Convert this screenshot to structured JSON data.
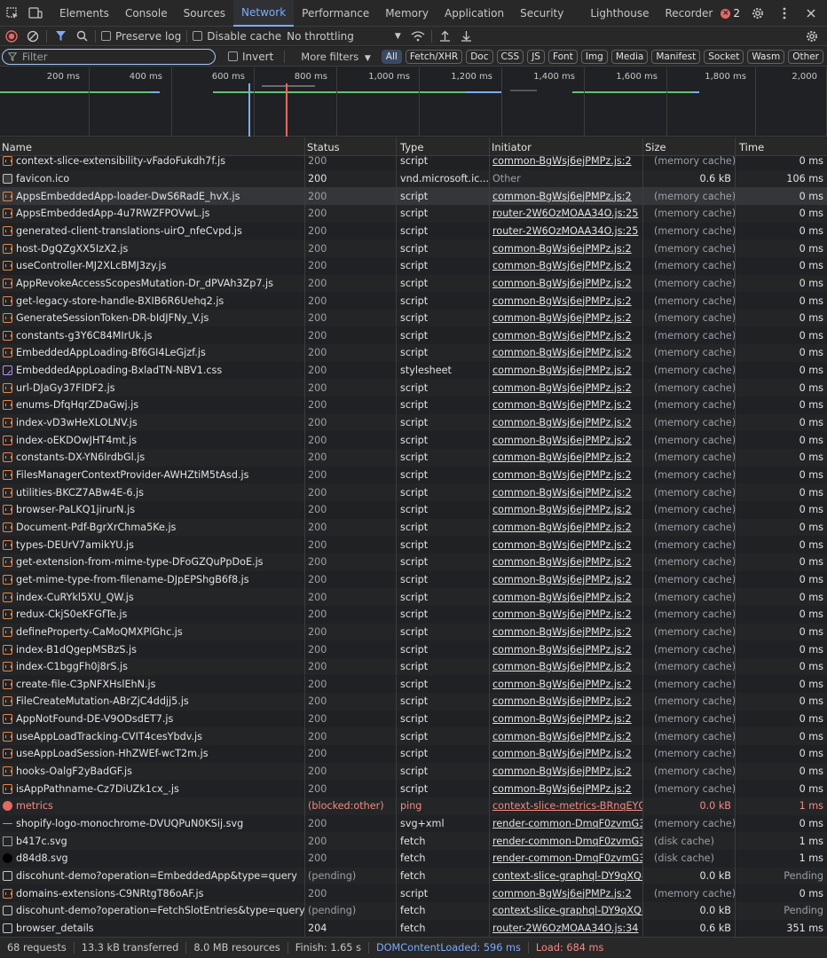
{
  "tabs": [
    "Elements",
    "Console",
    "Sources",
    "Network",
    "Performance",
    "Memory",
    "Application",
    "Security",
    "Lighthouse",
    "Recorder"
  ],
  "active_tab": "Network",
  "error_count": "2",
  "toolbar": {
    "preserve_log": "Preserve log",
    "disable_cache": "Disable cache",
    "throttling": "No throttling"
  },
  "filter": {
    "placeholder": "Filter",
    "invert": "Invert",
    "more_filters": "More filters"
  },
  "type_filters": [
    "All",
    "Fetch/XHR",
    "Doc",
    "CSS",
    "JS",
    "Font",
    "Img",
    "Media",
    "Manifest",
    "Socket",
    "Wasm",
    "Other"
  ],
  "overview_ticks": [
    "200 ms",
    "400 ms",
    "600 ms",
    "800 ms",
    "1,000 ms",
    "1,200 ms",
    "1,400 ms",
    "1,600 ms",
    "1,800 ms",
    "2,000"
  ],
  "columns": {
    "name": "Name",
    "status": "Status",
    "type": "Type",
    "initiator": "Initiator",
    "size": "Size",
    "time": "Time"
  },
  "rows": [
    {
      "name": "context-slice-extensibility-vFadoFukdh7f.js",
      "status": "200",
      "type": "script",
      "initiator": "common-BgWsj6ejPMPz.js:2",
      "size": "(memory cache)",
      "time": "0 ms",
      "icon": "script"
    },
    {
      "name": "favicon.ico",
      "status": "200",
      "type": "vnd.microsoft.ic...",
      "initiator": "Other",
      "size": "0.6 kB",
      "time": "106 ms",
      "icon": "doc"
    },
    {
      "name": "AppsEmbeddedApp-loader-DwS6RadE_hvX.js",
      "status": "200",
      "type": "script",
      "initiator": "common-BgWsj6ejPMPz.js:2",
      "size": "(memory cache)",
      "time": "0 ms",
      "icon": "script"
    },
    {
      "name": "AppsEmbeddedApp-4u7RWZFPOVwL.js",
      "status": "200",
      "type": "script",
      "initiator": "router-2W6OzMOAA34O.js:25",
      "size": "(memory cache)",
      "time": "0 ms",
      "icon": "script"
    },
    {
      "name": "generated-client-translations-uirO_nfeCvpd.js",
      "status": "200",
      "type": "script",
      "initiator": "router-2W6OzMOAA34O.js:25",
      "size": "(memory cache)",
      "time": "0 ms",
      "icon": "script"
    },
    {
      "name": "host-DgQZgXX5IzX2.js",
      "status": "200",
      "type": "script",
      "initiator": "common-BgWsj6ejPMPz.js:2",
      "size": "(memory cache)",
      "time": "0 ms",
      "icon": "script"
    },
    {
      "name": "useController-MJ2XLcBMJ3zy.js",
      "status": "200",
      "type": "script",
      "initiator": "common-BgWsj6ejPMPz.js:2",
      "size": "(memory cache)",
      "time": "0 ms",
      "icon": "script"
    },
    {
      "name": "AppRevokeAccessScopesMutation-Dr_dPVAh3Zp7.js",
      "status": "200",
      "type": "script",
      "initiator": "common-BgWsj6ejPMPz.js:2",
      "size": "(memory cache)",
      "time": "0 ms",
      "icon": "script"
    },
    {
      "name": "get-legacy-store-handle-BXIB6R6Uehq2.js",
      "status": "200",
      "type": "script",
      "initiator": "common-BgWsj6ejPMPz.js:2",
      "size": "(memory cache)",
      "time": "0 ms",
      "icon": "script"
    },
    {
      "name": "GenerateSessionToken-DR-bIdJFNy_V.js",
      "status": "200",
      "type": "script",
      "initiator": "common-BgWsj6ejPMPz.js:2",
      "size": "(memory cache)",
      "time": "0 ms",
      "icon": "script"
    },
    {
      "name": "constants-g3Y6C84MIrUk.js",
      "status": "200",
      "type": "script",
      "initiator": "common-BgWsj6ejPMPz.js:2",
      "size": "(memory cache)",
      "time": "0 ms",
      "icon": "script"
    },
    {
      "name": "EmbeddedAppLoading-Bf6GI4LeGjzf.js",
      "status": "200",
      "type": "script",
      "initiator": "common-BgWsj6ejPMPz.js:2",
      "size": "(memory cache)",
      "time": "0 ms",
      "icon": "script"
    },
    {
      "name": "EmbeddedAppLoading-BxladTN-NBV1.css",
      "status": "200",
      "type": "stylesheet",
      "initiator": "common-BgWsj6ejPMPz.js:2",
      "size": "(memory cache)",
      "time": "0 ms",
      "icon": "css"
    },
    {
      "name": "url-DJaGy37FIDF2.js",
      "status": "200",
      "type": "script",
      "initiator": "common-BgWsj6ejPMPz.js:2",
      "size": "(memory cache)",
      "time": "0 ms",
      "icon": "script"
    },
    {
      "name": "enums-DfqHqrZDaGwj.js",
      "status": "200",
      "type": "script",
      "initiator": "common-BgWsj6ejPMPz.js:2",
      "size": "(memory cache)",
      "time": "0 ms",
      "icon": "script"
    },
    {
      "name": "index-vD3wHeXLOLNV.js",
      "status": "200",
      "type": "script",
      "initiator": "common-BgWsj6ejPMPz.js:2",
      "size": "(memory cache)",
      "time": "0 ms",
      "icon": "script"
    },
    {
      "name": "index-oEKDOwJHT4mt.js",
      "status": "200",
      "type": "script",
      "initiator": "common-BgWsj6ejPMPz.js:2",
      "size": "(memory cache)",
      "time": "0 ms",
      "icon": "script"
    },
    {
      "name": "constants-DX-YN6lrdbGl.js",
      "status": "200",
      "type": "script",
      "initiator": "common-BgWsj6ejPMPz.js:2",
      "size": "(memory cache)",
      "time": "0 ms",
      "icon": "script"
    },
    {
      "name": "FilesManagerContextProvider-AWHZtiM5tAsd.js",
      "status": "200",
      "type": "script",
      "initiator": "common-BgWsj6ejPMPz.js:2",
      "size": "(memory cache)",
      "time": "0 ms",
      "icon": "script"
    },
    {
      "name": "utilities-BKCZ7ABw4E-6.js",
      "status": "200",
      "type": "script",
      "initiator": "common-BgWsj6ejPMPz.js:2",
      "size": "(memory cache)",
      "time": "0 ms",
      "icon": "script"
    },
    {
      "name": "browser-PaLKQ1jirurN.js",
      "status": "200",
      "type": "script",
      "initiator": "common-BgWsj6ejPMPz.js:2",
      "size": "(memory cache)",
      "time": "0 ms",
      "icon": "script"
    },
    {
      "name": "Document-Pdf-BgrXrChma5Ke.js",
      "status": "200",
      "type": "script",
      "initiator": "common-BgWsj6ejPMPz.js:2",
      "size": "(memory cache)",
      "time": "0 ms",
      "icon": "script"
    },
    {
      "name": "types-DEUrV7amikYU.js",
      "status": "200",
      "type": "script",
      "initiator": "common-BgWsj6ejPMPz.js:2",
      "size": "(memory cache)",
      "time": "0 ms",
      "icon": "script"
    },
    {
      "name": "get-extension-from-mime-type-DFoGZQuPpDoE.js",
      "status": "200",
      "type": "script",
      "initiator": "common-BgWsj6ejPMPz.js:2",
      "size": "(memory cache)",
      "time": "0 ms",
      "icon": "script"
    },
    {
      "name": "get-mime-type-from-filename-DJpEPShgB6f8.js",
      "status": "200",
      "type": "script",
      "initiator": "common-BgWsj6ejPMPz.js:2",
      "size": "(memory cache)",
      "time": "0 ms",
      "icon": "script"
    },
    {
      "name": "index-CuRYkl5XU_QW.js",
      "status": "200",
      "type": "script",
      "initiator": "common-BgWsj6ejPMPz.js:2",
      "size": "(memory cache)",
      "time": "0 ms",
      "icon": "script"
    },
    {
      "name": "redux-CkjS0eKFGfTe.js",
      "status": "200",
      "type": "script",
      "initiator": "common-BgWsj6ejPMPz.js:2",
      "size": "(memory cache)",
      "time": "0 ms",
      "icon": "script"
    },
    {
      "name": "defineProperty-CaMoQMXPlGhc.js",
      "status": "200",
      "type": "script",
      "initiator": "common-BgWsj6ejPMPz.js:2",
      "size": "(memory cache)",
      "time": "0 ms",
      "icon": "script"
    },
    {
      "name": "index-B1dQgepMSBzS.js",
      "status": "200",
      "type": "script",
      "initiator": "common-BgWsj6ejPMPz.js:2",
      "size": "(memory cache)",
      "time": "0 ms",
      "icon": "script"
    },
    {
      "name": "index-C1bggFh0j8rS.js",
      "status": "200",
      "type": "script",
      "initiator": "common-BgWsj6ejPMPz.js:2",
      "size": "(memory cache)",
      "time": "0 ms",
      "icon": "script"
    },
    {
      "name": "create-file-C3pNFXHslEhN.js",
      "status": "200",
      "type": "script",
      "initiator": "common-BgWsj6ejPMPz.js:2",
      "size": "(memory cache)",
      "time": "0 ms",
      "icon": "script"
    },
    {
      "name": "FileCreateMutation-ABrZjC4ddjj5.js",
      "status": "200",
      "type": "script",
      "initiator": "common-BgWsj6ejPMPz.js:2",
      "size": "(memory cache)",
      "time": "0 ms",
      "icon": "script"
    },
    {
      "name": "AppNotFound-DE-V9ODsdET7.js",
      "status": "200",
      "type": "script",
      "initiator": "common-BgWsj6ejPMPz.js:2",
      "size": "(memory cache)",
      "time": "0 ms",
      "icon": "script"
    },
    {
      "name": "useAppLoadTracking-CVIT4cesYbdv.js",
      "status": "200",
      "type": "script",
      "initiator": "common-BgWsj6ejPMPz.js:2",
      "size": "(memory cache)",
      "time": "0 ms",
      "icon": "script"
    },
    {
      "name": "useAppLoadSession-HhZWEf-wcT2m.js",
      "status": "200",
      "type": "script",
      "initiator": "common-BgWsj6ejPMPz.js:2",
      "size": "(memory cache)",
      "time": "0 ms",
      "icon": "script"
    },
    {
      "name": "hooks-OalgF2yBadGF.js",
      "status": "200",
      "type": "script",
      "initiator": "common-BgWsj6ejPMPz.js:2",
      "size": "(memory cache)",
      "time": "0 ms",
      "icon": "script"
    },
    {
      "name": "isAppPathname-Cz7DiUZk1cx_.js",
      "status": "200",
      "type": "script",
      "initiator": "common-BgWsj6ejPMPz.js:2",
      "size": "(memory cache)",
      "time": "0 ms",
      "icon": "script"
    },
    {
      "name": "metrics",
      "status": "(blocked:other)",
      "type": "ping",
      "initiator": "context-slice-metrics-BRnqEYG",
      "size": "0.0 kB",
      "time": "1 ms",
      "icon": "err"
    },
    {
      "name": "shopify-logo-monochrome-DVUQPuN0KSij.svg",
      "status": "200",
      "type": "svg+xml",
      "initiator": "render-common-DmqF0zvmG3\\",
      "size": "(memory cache)",
      "time": "0 ms",
      "icon": "dash"
    },
    {
      "name": "b417c.svg",
      "status": "200",
      "type": "fetch",
      "initiator": "render-common-DmqF0zvmG3\\",
      "size": "(disk cache)",
      "time": "1 ms",
      "icon": "img"
    },
    {
      "name": "d84d8.svg",
      "status": "200",
      "type": "fetch",
      "initiator": "render-common-DmqF0zvmG3\\",
      "size": "(disk cache)",
      "time": "1 ms",
      "icon": "svg"
    },
    {
      "name": "discohunt-demo?operation=EmbeddedApp&type=query",
      "status": "(pending)",
      "type": "fetch",
      "initiator": "context-slice-graphql-DY9qXQ8",
      "size": "0.0 kB",
      "time": "Pending",
      "icon": "fetch"
    },
    {
      "name": "domains-extensions-C9NRtgT86oAF.js",
      "status": "200",
      "type": "script",
      "initiator": "common-BgWsj6ejPMPz.js:2",
      "size": "(memory cache)",
      "time": "0 ms",
      "icon": "script"
    },
    {
      "name": "discohunt-demo?operation=FetchSlotEntries&type=query",
      "status": "(pending)",
      "type": "fetch",
      "initiator": "context-slice-graphql-DY9qXQ8",
      "size": "0.0 kB",
      "time": "Pending",
      "icon": "fetch"
    },
    {
      "name": "browser_details",
      "status": "204",
      "type": "fetch",
      "initiator": "router-2W6OzMOAA34O.js:34",
      "size": "0.6 kB",
      "time": "351 ms",
      "icon": "fetch"
    }
  ],
  "status_bar": {
    "requests": "68 requests",
    "transferred": "13.3 kB transferred",
    "resources": "8.0 MB resources",
    "finish": "Finish: 1.65 s",
    "dom_loaded": "DOMContentLoaded: 596 ms",
    "load": "Load: 684 ms"
  },
  "colors": {
    "accent": "#7cacf8",
    "error": "#f28b82",
    "script_icon": "#e8864a",
    "css_icon": "#b792f0"
  }
}
